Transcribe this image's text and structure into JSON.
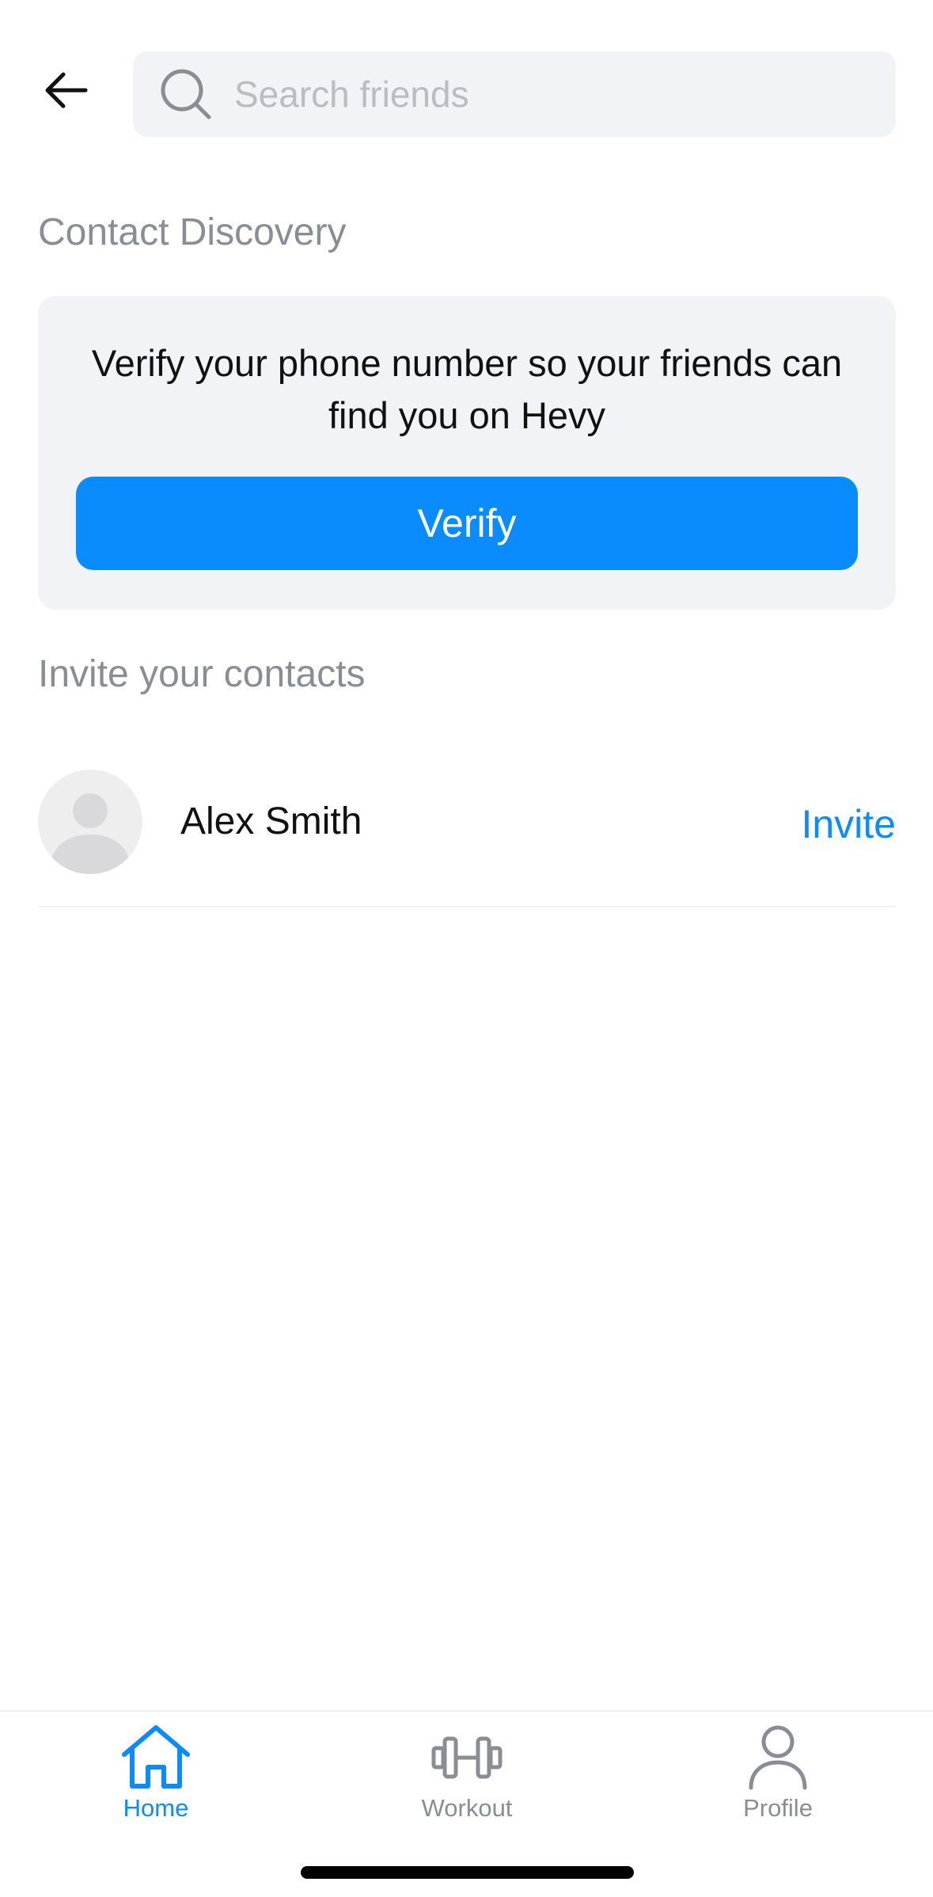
{
  "header": {
    "back_icon": "arrow-left-icon",
    "search": {
      "icon": "search-icon",
      "placeholder": "Search friends",
      "value": ""
    }
  },
  "contact_discovery": {
    "title": "Contact Discovery",
    "message": "Verify your phone number so your friends can find you on Hevy",
    "verify_label": "Verify"
  },
  "invite_section": {
    "title": "Invite your contacts",
    "contacts": [
      {
        "name": "Alex Smith",
        "action": "Invite"
      }
    ]
  },
  "tab_bar": {
    "active": "Home",
    "tabs": [
      {
        "label": "Home",
        "icon": "home-icon"
      },
      {
        "label": "Workout",
        "icon": "dumbbell-icon"
      },
      {
        "label": "Profile",
        "icon": "person-icon"
      }
    ]
  },
  "colors": {
    "accent": "#0a8cff",
    "muted_text": "#8a8d93",
    "card_background": "#f2f3f6"
  }
}
